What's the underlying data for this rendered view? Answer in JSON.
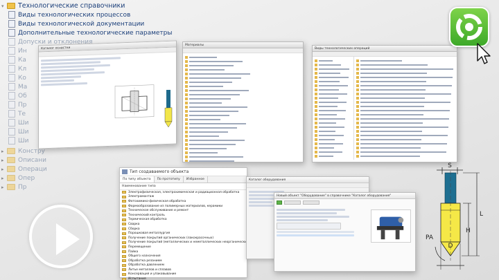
{
  "tree": {
    "root": "Технологические справочники",
    "items": [
      {
        "label": "Виды технологических процессов",
        "faded": false
      },
      {
        "label": "Виды технологической документации",
        "faded": false
      },
      {
        "label": "Дополнительные технологические параметры",
        "faded": false
      },
      {
        "label": "Допуски и отклонения",
        "faded": true
      },
      {
        "label": "Ин",
        "faded": true
      },
      {
        "label": "Ка",
        "faded": true
      },
      {
        "label": "Кл",
        "faded": true
      },
      {
        "label": "Ко",
        "faded": true
      },
      {
        "label": "Ма",
        "faded": true
      },
      {
        "label": "Об",
        "faded": true
      },
      {
        "label": "Пр",
        "faded": true
      },
      {
        "label": "Те",
        "faded": true
      },
      {
        "label": "Ши",
        "faded": true
      },
      {
        "label": "Ши",
        "faded": true
      },
      {
        "label": "Ши",
        "faded": true
      }
    ],
    "bottom_items": [
      {
        "label": "Констру",
        "faded": true
      },
      {
        "label": "Описани",
        "faded": true
      },
      {
        "label": "Операци",
        "faded": true
      },
      {
        "label": "Опер",
        "faded": true
      },
      {
        "label": "Пр",
        "faded": true
      }
    ]
  },
  "object_window": {
    "title": "Тип создаваемого объекта",
    "tabs": [
      "По типу объекта",
      "По прототипу",
      "Избранное"
    ],
    "column_header": "Наименование типа",
    "rows": [
      "Электрофизическая, электрохимическая и радиационная обработка",
      "Электромонтаж",
      "Фотохимико-физическая обработка",
      "Формообразование из полимерных материалов, керамики",
      "Техническое обслуживание и ремонт",
      "Технический контроль",
      "Термическая обработка",
      "Сварка",
      "Сборка",
      "Порошковая металлургия",
      "Получение покрытий органических (лакокрасочных)",
      "Получение покрытий (металлических и неметаллических неорганических)",
      "Перемещение",
      "Пайка",
      "Общего назначения",
      "Обработка резанием",
      "Обработка давлением",
      "Литье металлов и сплавов",
      "Консервация и упаковывание",
      "Испытания",
      "Группа"
    ]
  },
  "equipment_window": {
    "title": "Каталог оборудования",
    "card_title": "Новый объект \"Оборудование\" в справочнике \"Каталог оборудования\""
  },
  "shots": {
    "shot1_title": "Каталог оснастки",
    "shot2_title": "Материалы",
    "shot3_title": "Виды технологических операций"
  },
  "diagram": {
    "labels": [
      "S",
      "H",
      "L",
      "PA",
      "D"
    ]
  },
  "colors": {
    "logo_green": "#4cb82e",
    "folder": "#f0c24a",
    "link_blue": "#1b3f7a"
  }
}
